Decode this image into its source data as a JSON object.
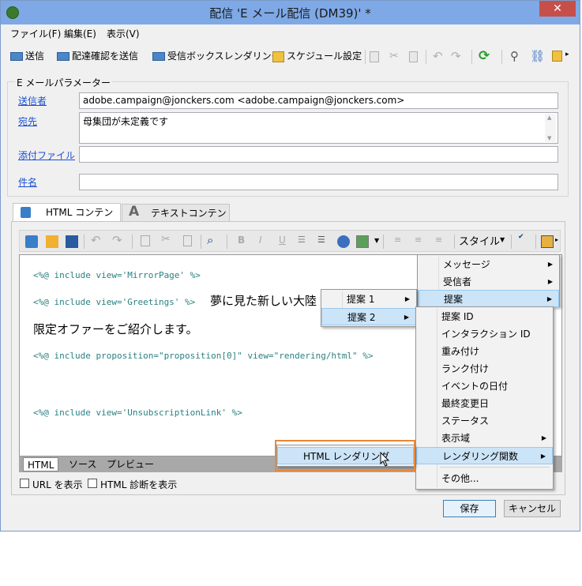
{
  "window": {
    "title": "配信 'E メール配信 (DM39)' *",
    "close_glyph": "✕"
  },
  "menubar": {
    "items": [
      {
        "label": "ファイル(F)"
      },
      {
        "label": "編集(E)"
      },
      {
        "label": "表示(V)"
      }
    ]
  },
  "toolbar": {
    "send": "送信",
    "proof": "配達確認を送信",
    "inbox_rendering": "受信ボックスレンダリング",
    "schedule": "スケジュール設定"
  },
  "params": {
    "legend": "E メールパラメーター",
    "from_label": "送信者",
    "from_value": "adobe.campaign@jonckers.com <adobe.campaign@jonckers.com>",
    "to_label": "宛先",
    "to_value": "母集団が未定義です",
    "attach_label": "添付ファイル",
    "attach_value": "",
    "subject_label": "件名",
    "subject_value": ""
  },
  "tabs": {
    "html": "HTML コンテンツ",
    "text": "テキストコンテンツ"
  },
  "editor_toolbar": {
    "style": "スタイル"
  },
  "editor": {
    "line1": "<%@ include view='MirrorPage' %>",
    "line2": "<%@ include view='Greetings' %>",
    "line2_text": "夢に見た新しい大陸",
    "line3": "限定オファーをご紹介します。",
    "line4": "<%@ include proposition=\"proposition[0]\" view=\"rendering/html\" %>",
    "line5": "<%@ include view='UnsubscriptionLink' %>"
  },
  "bottom_tabs": {
    "html": "HTML",
    "source": "ソース",
    "preview": "プレビュー"
  },
  "options": {
    "show_url": "URL を表示",
    "html_diag": "HTML 診断を表示"
  },
  "buttons": {
    "save": "保存",
    "cancel": "キャンセル"
  },
  "context_menu": {
    "main": [
      {
        "label": "メッセージ",
        "submenu": true
      },
      {
        "label": "受信者",
        "submenu": true
      },
      {
        "label": "提案",
        "submenu": true
      }
    ],
    "proposal_sub": [
      {
        "label": "提案 1",
        "submenu": true
      },
      {
        "label": "提案 2",
        "submenu": true
      }
    ],
    "proposal_items": [
      {
        "label": "提案 ID"
      },
      {
        "label": "インタラクション ID"
      },
      {
        "label": "重み付け"
      },
      {
        "label": "ランク付け"
      },
      {
        "label": "イベントの日付"
      },
      {
        "label": "最終変更日"
      },
      {
        "label": "ステータス"
      },
      {
        "label": "表示域",
        "submenu": true
      },
      {
        "label": "レンダリング関数",
        "submenu": true
      },
      {
        "label": "その他..."
      }
    ],
    "rendering_sub": [
      {
        "label": "HTML レンダリング"
      }
    ]
  },
  "colors": {
    "titlebar": "#7ea9e6",
    "link": "#1a4fd1",
    "code": "#2a8080",
    "highlight": "#cce4f7",
    "callout": "#e8883a"
  }
}
